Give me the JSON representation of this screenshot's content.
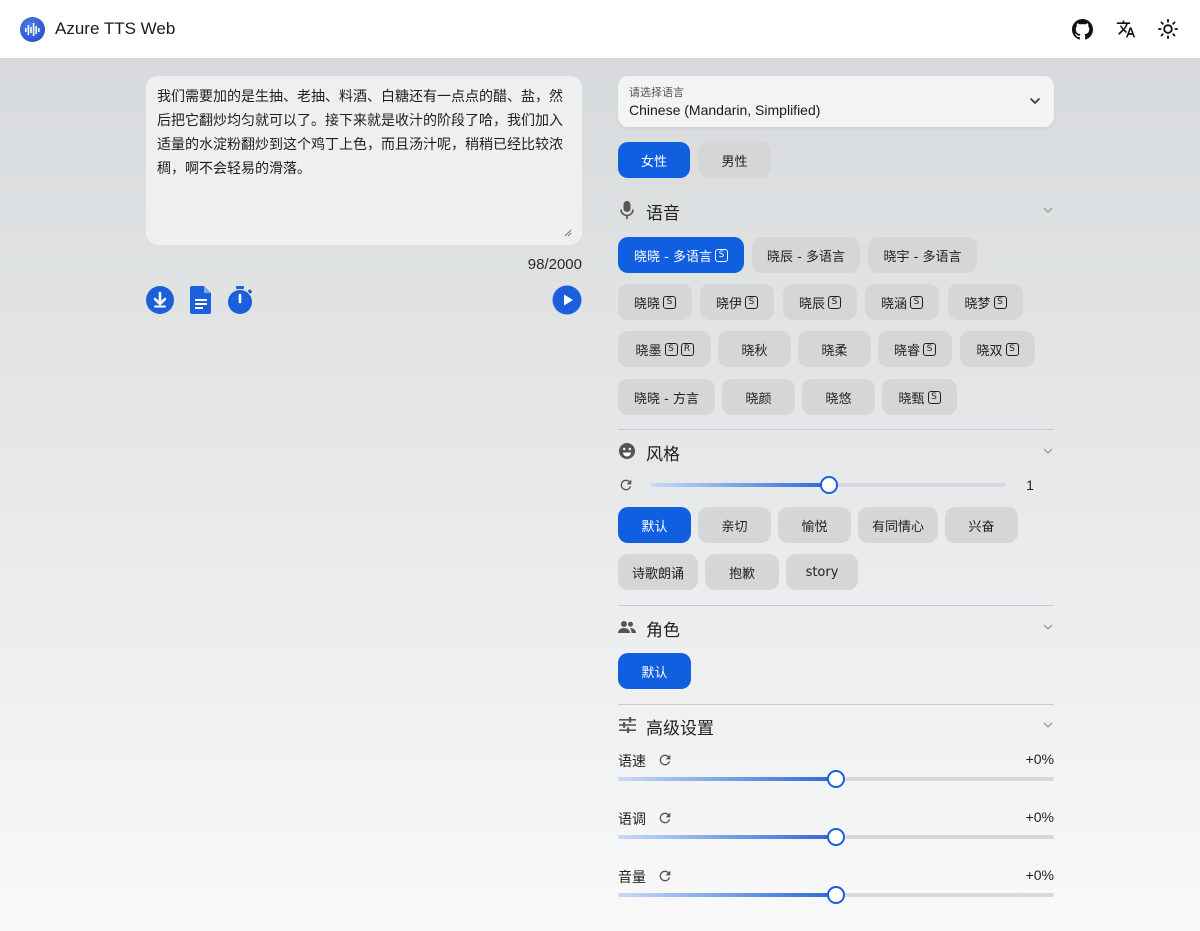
{
  "app": {
    "title": "Azure TTS Web"
  },
  "header_icons": [
    "github-icon",
    "translate-icon",
    "sun-icon"
  ],
  "editor": {
    "text": "我们需要加的是生抽、老抽、料酒、白糖还有一点点的醋、盐，然后把它翻炒均匀就可以了。接下来就是收汁的阶段了哈，我们加入适量的水淀粉翻炒到这个鸡丁上色，而且汤汁呢，稍稍已经比较浓稠，啊不会轻易的滑落。",
    "char_count": "98/2000"
  },
  "language": {
    "label": "请选择语言",
    "value": "Chinese (Mandarin, Simplified)"
  },
  "gender": {
    "female": "女性",
    "male": "男性",
    "selected": "female"
  },
  "voice": {
    "title": "语音",
    "items": [
      {
        "label": "晓晓 - 多语言",
        "badges": [
          "S"
        ],
        "active": true
      },
      {
        "label": "晓辰 - 多语言",
        "badges": [],
        "active": false
      },
      {
        "label": "晓宇 - 多语言",
        "badges": [],
        "active": false
      },
      {
        "label": "晓晓",
        "badges": [
          "S"
        ],
        "active": false
      },
      {
        "label": "晓伊",
        "badges": [
          "S"
        ],
        "active": false
      },
      {
        "label": "晓辰",
        "badges": [
          "S"
        ],
        "active": false
      },
      {
        "label": "晓涵",
        "badges": [
          "S"
        ],
        "active": false
      },
      {
        "label": "晓梦",
        "badges": [
          "S"
        ],
        "active": false
      },
      {
        "label": "晓墨",
        "badges": [
          "S",
          "R"
        ],
        "active": false
      },
      {
        "label": "晓秋",
        "badges": [],
        "active": false
      },
      {
        "label": "晓柔",
        "badges": [],
        "active": false
      },
      {
        "label": "晓睿",
        "badges": [
          "S"
        ],
        "active": false
      },
      {
        "label": "晓双",
        "badges": [
          "S"
        ],
        "active": false
      },
      {
        "label": "晓晓 - 方言",
        "badges": [],
        "active": false
      },
      {
        "label": "晓颜",
        "badges": [],
        "active": false
      },
      {
        "label": "晓悠",
        "badges": [],
        "active": false
      },
      {
        "label": "晓甄",
        "badges": [
          "S"
        ],
        "active": false
      }
    ]
  },
  "style": {
    "title": "风格",
    "intensity_value": "1",
    "intensity_fraction": 0.5,
    "items": [
      {
        "label": "默认",
        "active": true
      },
      {
        "label": "亲切",
        "active": false
      },
      {
        "label": "愉悦",
        "active": false
      },
      {
        "label": "有同情心",
        "active": false
      },
      {
        "label": "兴奋",
        "active": false
      },
      {
        "label": "诗歌朗诵",
        "active": false
      },
      {
        "label": "抱歉",
        "active": false
      },
      {
        "label": "story",
        "active": false
      }
    ]
  },
  "role": {
    "title": "角色",
    "items": [
      {
        "label": "默认",
        "active": true
      }
    ]
  },
  "advanced": {
    "title": "高级设置",
    "rate": {
      "label": "语速",
      "value": "+0%",
      "fraction": 0.5
    },
    "pitch": {
      "label": "语调",
      "value": "+0%",
      "fraction": 0.5
    },
    "volume": {
      "label": "音量",
      "value": "+0%",
      "fraction": 0.5
    }
  },
  "colors": {
    "accent": "#0f5fe0",
    "button": "#d4d6d8",
    "text": "#1f1f1f"
  }
}
